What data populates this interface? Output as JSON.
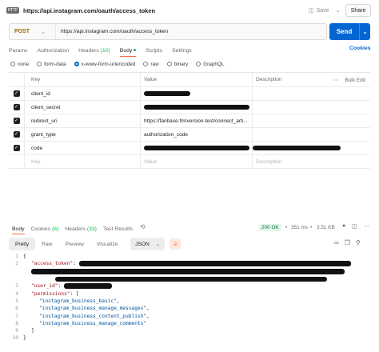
{
  "title_bar": {
    "badge": "HTTP",
    "url": "https://api.instagram.com/oauth/access_token",
    "save_label": "Save",
    "share_label": "Share"
  },
  "request": {
    "method": "POST",
    "url": "https://api.instagram.com/oauth/access_token",
    "send_label": "Send"
  },
  "request_tabs": [
    {
      "label": "Params"
    },
    {
      "label": "Authorization"
    },
    {
      "label": "Headers",
      "count": "(10)"
    },
    {
      "label": "Body"
    },
    {
      "label": "Scripts"
    },
    {
      "label": "Settings"
    }
  ],
  "cookies_link": "Cookies",
  "body_types": [
    "none",
    "form-data",
    "x-www-form-urlencoded",
    "raw",
    "binary",
    "GraphQL"
  ],
  "body_type_selected": "x-www-form-urlencoded",
  "params_table": {
    "headers": [
      "Key",
      "Value",
      "Description",
      "Bulk Edit"
    ],
    "rows": [
      {
        "key": "client_id",
        "value": "",
        "redacted": true
      },
      {
        "key": "client_secret",
        "value": "",
        "redacted": true
      },
      {
        "key": "redirect_uri",
        "value": "https://fanbase.fm/version-test/connect_arti...",
        "redacted": false
      },
      {
        "key": "grant_type",
        "value": "authorization_code",
        "redacted": false
      },
      {
        "key": "code",
        "value": "",
        "redacted": true
      }
    ],
    "placeholder": {
      "key": "Key",
      "value": "Value",
      "description": "Description"
    }
  },
  "response_tabs": [
    {
      "label": "Body"
    },
    {
      "label": "Cookies",
      "count": "(6)"
    },
    {
      "label": "Headers",
      "count": "(33)"
    },
    {
      "label": "Test Results"
    }
  ],
  "response_meta": {
    "status": "200 OK",
    "time": "351 ms",
    "size": "3.51 KB"
  },
  "response_views": [
    "Pretty",
    "Raw",
    "Preview",
    "Visualize"
  ],
  "response_format": "JSON",
  "code_lines": [
    {
      "n": "1",
      "text": "{"
    },
    {
      "n": "2",
      "key": "\"access_token\"",
      "after": ":"
    },
    {
      "n": "3",
      "key": "\"user_id\"",
      "after": ":"
    },
    {
      "n": "4",
      "key": "\"permissions\"",
      "after": ": ["
    },
    {
      "n": "5",
      "str": "\"instagram_business_basic\"",
      "after": ","
    },
    {
      "n": "6",
      "str": "\"instagram_business_manage_messages\"",
      "after": ","
    },
    {
      "n": "7",
      "str": "\"instagram_business_content_publish\"",
      "after": ","
    },
    {
      "n": "8",
      "str": "\"instagram_business_manage_comments\"",
      "after": ""
    },
    {
      "n": "9",
      "text": "]"
    },
    {
      "n": "10",
      "text": "}"
    }
  ],
  "icons": {
    "save": "floppy-icon",
    "history": "history-icon",
    "globe": "globe-icon",
    "more": "more-icon",
    "copy": "copy-icon",
    "search": "search-icon",
    "link": "link-icon",
    "wrap": "wrap-lines-icon"
  },
  "colors": {
    "send": "#0265d2",
    "method": "#a56400",
    "active_tab_underline": "#ff6c37",
    "status_ok": "#067a34"
  }
}
